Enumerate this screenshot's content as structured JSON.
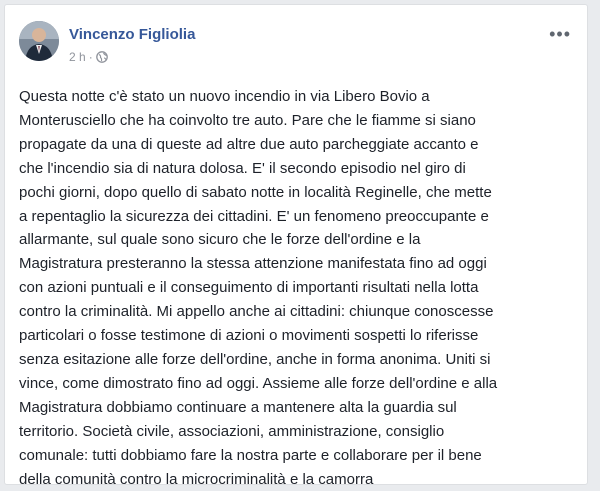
{
  "post": {
    "author": "Vincenzo Figliolia",
    "time": "2 h",
    "dot": "·",
    "privacy_icon": "globe-icon",
    "more_icon": "more-options-icon",
    "more_glyph": "•••",
    "lines": [
      "Questa notte c'è stato un nuovo incendio in via Libero Bovio a",
      "Monterusciello che ha coinvolto tre auto. Pare che le fiamme si siano",
      "propagate da una di queste ad altre due auto parcheggiate accanto e",
      "che l'incendio sia di natura dolosa. E' il secondo episodio nel giro di",
      "pochi giorni, dopo quello di sabato notte in località Reginelle, che mette",
      "a repentaglio la sicurezza dei cittadini. E' un fenomeno preoccupante e",
      "allarmante, sul quale sono sicuro che le forze dell'ordine e la",
      "Magistratura presteranno la stessa attenzione manifestata fino ad oggi",
      "con azioni puntuali e il conseguimento di importanti risultati nella lotta",
      "contro la criminalità. Mi appello anche ai cittadini: chiunque conoscesse",
      "particolari o fosse testimone di azioni o movimenti sospetti lo riferisse",
      "senza esitazione alle forze dell'ordine, anche in forma anonima. Uniti si",
      "vince, come dimostrato fino ad oggi. Assieme alle forze dell'ordine e alla",
      "Magistratura dobbiamo continuare a mantenere alta la guardia sul",
      "territorio. Società civile, associazioni, amministrazione, consiglio",
      "comunale: tutti dobbiamo fare la nostra parte e collaborare per il bene",
      "della comunità contro la microcriminalità e la camorra"
    ]
  },
  "colors": {
    "author": "#365899",
    "text": "#1d2129",
    "meta": "#90949c",
    "background": "#e9ebee"
  }
}
